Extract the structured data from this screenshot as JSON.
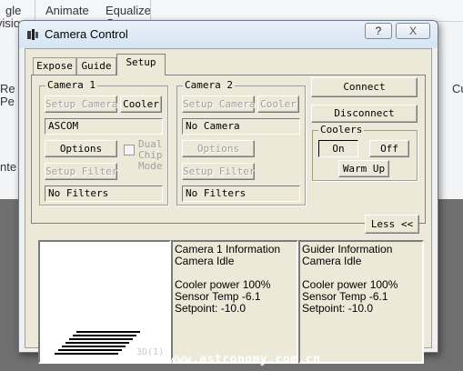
{
  "background_app": {
    "ribbon_top_left_1": "gle",
    "ribbon_top_left_2": "vision",
    "ribbon_top_animate": "Animate",
    "ribbon_top_equalize": "Equalize",
    "ribbon_top_partial": "C",
    "ribbon_mid_left_1": "Re",
    "ribbon_mid_left_2": "Pe",
    "ribbon_mid_right": "Cu",
    "ribbon_low_left": "nte"
  },
  "dialog": {
    "title": "Camera Control",
    "help_label": "?",
    "close_label": "X"
  },
  "tabs": [
    {
      "label": "Expose"
    },
    {
      "label": "Guide"
    },
    {
      "label": "Setup"
    }
  ],
  "camera1": {
    "title": "Camera 1",
    "setup_camera_label": "Setup Camera",
    "cooler_label": "Cooler",
    "camera_name": "ASCOM",
    "options_label": "Options",
    "dual_chip_label": "Dual Chip Mode",
    "setup_filter_label": "Setup Filter",
    "filter_value": "No Filters"
  },
  "camera2": {
    "title": "Camera 2",
    "setup_camera_label": "Setup Camera",
    "cooler_label": "Cooler",
    "camera_name": "No Camera",
    "options_label": "Options",
    "setup_filter_label": "Setup Filter",
    "filter_value": "No Filters"
  },
  "connection": {
    "connect_label": "Connect",
    "disconnect_label": "Disconnect"
  },
  "coolers": {
    "title": "Coolers",
    "on_label": "On",
    "off_label": "Off",
    "warm_up_label": "Warm Up"
  },
  "less_label": "Less <<",
  "preview": {
    "label": "3D(1)"
  },
  "info_camera1": {
    "line1": "Camera 1 Information",
    "line2": "Camera Idle",
    "line3": "Cooler power 100%",
    "line4": "Sensor Temp -6.1",
    "line5": "Setpoint: -10.0"
  },
  "info_guider": {
    "line1": "Guider Information",
    "line2": "Camera Idle",
    "line3": "Cooler power 100%",
    "line4": "Sensor Temp -6.1",
    "line5": "Setpoint: -10.0"
  },
  "watermark": "www.astronomy.com.cn"
}
